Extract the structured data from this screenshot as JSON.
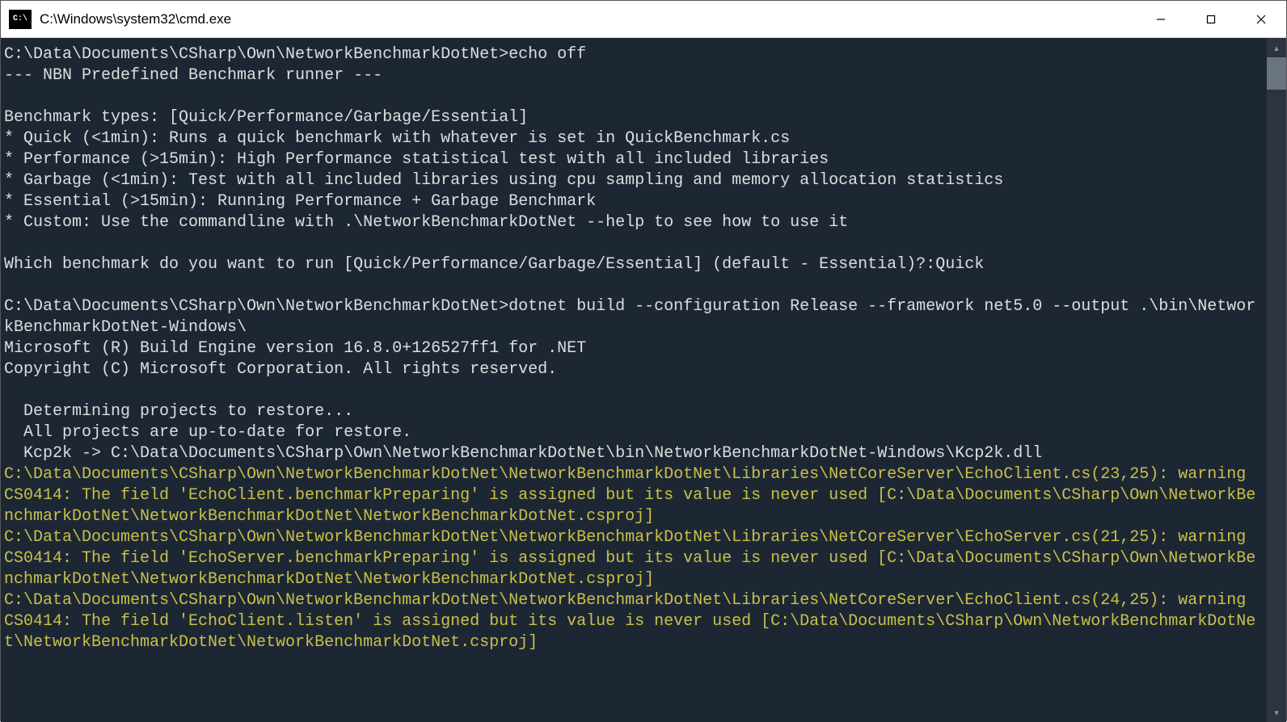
{
  "window": {
    "title": "C:\\Windows\\system32\\cmd.exe"
  },
  "terminal": {
    "lines": [
      {
        "text": "C:\\Data\\Documents\\CSharp\\Own\\NetworkBenchmarkDotNet>echo off",
        "class": ""
      },
      {
        "text": "--- NBN Predefined Benchmark runner ---",
        "class": ""
      },
      {
        "text": "",
        "class": ""
      },
      {
        "text": "Benchmark types: [Quick/Performance/Garbage/Essential]",
        "class": ""
      },
      {
        "text": "* Quick (<1min): Runs a quick benchmark with whatever is set in QuickBenchmark.cs",
        "class": ""
      },
      {
        "text": "* Performance (>15min): High Performance statistical test with all included libraries",
        "class": ""
      },
      {
        "text": "* Garbage (<1min): Test with all included libraries using cpu sampling and memory allocation statistics",
        "class": ""
      },
      {
        "text": "* Essential (>15min): Running Performance + Garbage Benchmark",
        "class": ""
      },
      {
        "text": "* Custom: Use the commandline with .\\NetworkBenchmarkDotNet --help to see how to use it",
        "class": ""
      },
      {
        "text": "",
        "class": ""
      },
      {
        "text": "Which benchmark do you want to run [Quick/Performance/Garbage/Essential] (default - Essential)?:Quick",
        "class": ""
      },
      {
        "text": "",
        "class": ""
      },
      {
        "text": "C:\\Data\\Documents\\CSharp\\Own\\NetworkBenchmarkDotNet>dotnet build --configuration Release --framework net5.0 --output .\\bin\\NetworkBenchmarkDotNet-Windows\\",
        "class": ""
      },
      {
        "text": "Microsoft (R) Build Engine version 16.8.0+126527ff1 for .NET",
        "class": ""
      },
      {
        "text": "Copyright (C) Microsoft Corporation. All rights reserved.",
        "class": ""
      },
      {
        "text": "",
        "class": ""
      },
      {
        "text": "  Determining projects to restore...",
        "class": ""
      },
      {
        "text": "  All projects are up-to-date for restore.",
        "class": ""
      },
      {
        "text": "  Kcp2k -> C:\\Data\\Documents\\CSharp\\Own\\NetworkBenchmarkDotNet\\bin\\NetworkBenchmarkDotNet-Windows\\Kcp2k.dll",
        "class": ""
      },
      {
        "text": "C:\\Data\\Documents\\CSharp\\Own\\NetworkBenchmarkDotNet\\NetworkBenchmarkDotNet\\Libraries\\NetCoreServer\\EchoClient.cs(23,25): warning CS0414: The field 'EchoClient.benchmarkPreparing' is assigned but its value is never used [C:\\Data\\Documents\\CSharp\\Own\\NetworkBenchmarkDotNet\\NetworkBenchmarkDotNet\\NetworkBenchmarkDotNet.csproj]",
        "class": "warn"
      },
      {
        "text": "C:\\Data\\Documents\\CSharp\\Own\\NetworkBenchmarkDotNet\\NetworkBenchmarkDotNet\\Libraries\\NetCoreServer\\EchoServer.cs(21,25): warning CS0414: The field 'EchoServer.benchmarkPreparing' is assigned but its value is never used [C:\\Data\\Documents\\CSharp\\Own\\NetworkBenchmarkDotNet\\NetworkBenchmarkDotNet\\NetworkBenchmarkDotNet.csproj]",
        "class": "warn"
      },
      {
        "text": "C:\\Data\\Documents\\CSharp\\Own\\NetworkBenchmarkDotNet\\NetworkBenchmarkDotNet\\Libraries\\NetCoreServer\\EchoClient.cs(24,25): warning CS0414: The field 'EchoClient.listen' is assigned but its value is never used [C:\\Data\\Documents\\CSharp\\Own\\NetworkBenchmarkDotNet\\NetworkBenchmarkDotNet\\NetworkBenchmarkDotNet.csproj]",
        "class": "warn"
      }
    ]
  }
}
